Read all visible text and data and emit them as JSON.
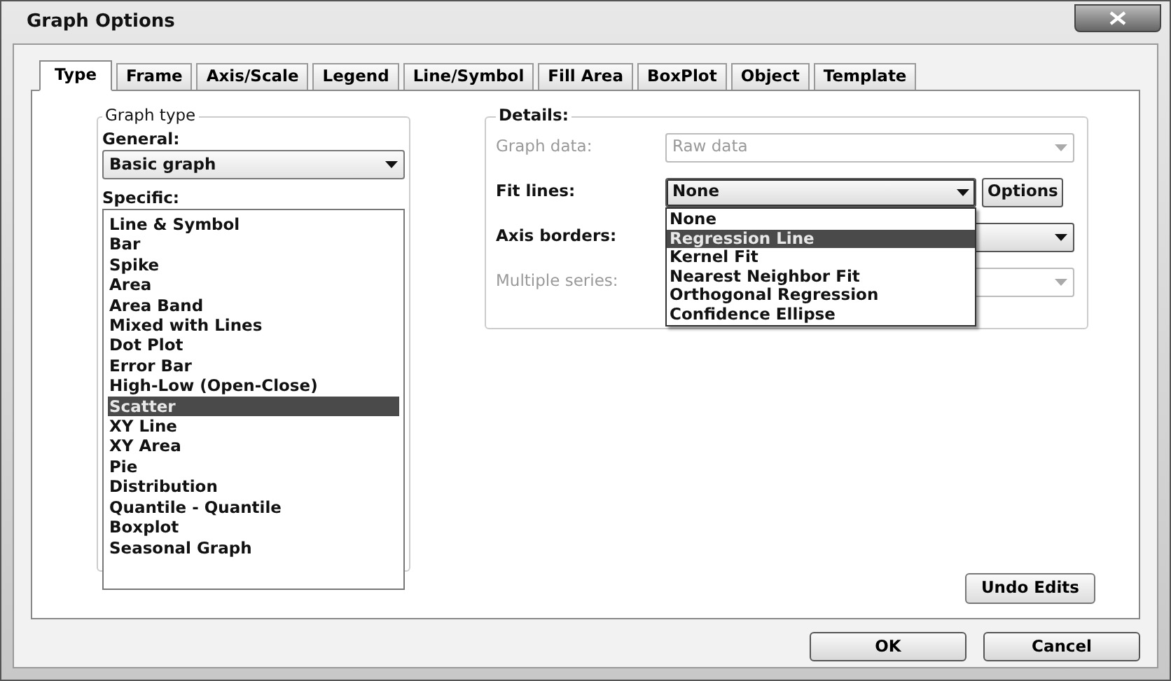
{
  "window": {
    "title": "Graph Options"
  },
  "tabs": [
    {
      "label": "Type",
      "selected": true
    },
    {
      "label": "Frame",
      "selected": false
    },
    {
      "label": "Axis/Scale",
      "selected": false
    },
    {
      "label": "Legend",
      "selected": false
    },
    {
      "label": "Line/Symbol",
      "selected": false
    },
    {
      "label": "Fill Area",
      "selected": false
    },
    {
      "label": "BoxPlot",
      "selected": false
    },
    {
      "label": "Object",
      "selected": false
    },
    {
      "label": "Template",
      "selected": false
    }
  ],
  "graph_type": {
    "title": "Graph type",
    "general_label": "General:",
    "general_value": "Basic graph",
    "specific_label": "Specific:",
    "specific_items": [
      {
        "label": "Line & Symbol",
        "selected": false
      },
      {
        "label": "Bar",
        "selected": false
      },
      {
        "label": "Spike",
        "selected": false
      },
      {
        "label": "Area",
        "selected": false
      },
      {
        "label": "Area Band",
        "selected": false
      },
      {
        "label": "Mixed with Lines",
        "selected": false
      },
      {
        "label": "Dot Plot",
        "selected": false
      },
      {
        "label": "Error Bar",
        "selected": false
      },
      {
        "label": "High-Low (Open-Close)",
        "selected": false
      },
      {
        "label": "Scatter",
        "selected": true
      },
      {
        "label": "XY Line",
        "selected": false
      },
      {
        "label": "XY Area",
        "selected": false
      },
      {
        "label": "Pie",
        "selected": false
      },
      {
        "label": "Distribution",
        "selected": false
      },
      {
        "label": "Quantile - Quantile",
        "selected": false
      },
      {
        "label": "Boxplot",
        "selected": false
      },
      {
        "label": "Seasonal Graph",
        "selected": false
      }
    ]
  },
  "details": {
    "title": "Details:",
    "rows": [
      {
        "label": "Graph data:",
        "value": "Raw data",
        "disabled": true
      },
      {
        "label": "Fit lines:",
        "value": "None",
        "disabled": false,
        "button": "Options",
        "open": true
      },
      {
        "label": "Axis borders:",
        "disabled": false
      },
      {
        "label": "Multiple series:",
        "disabled": true
      }
    ],
    "fit_lines_options": [
      {
        "label": "None",
        "selected": false
      },
      {
        "label": "Regression Line",
        "selected": true
      },
      {
        "label": "Kernel Fit",
        "selected": false
      },
      {
        "label": "Nearest Neighbor Fit",
        "selected": false
      },
      {
        "label": "Orthogonal Regression",
        "selected": false
      },
      {
        "label": "Confidence Ellipse",
        "selected": false
      }
    ]
  },
  "undo_button": "Undo Edits",
  "buttons": [
    "OK",
    "Cancel"
  ]
}
